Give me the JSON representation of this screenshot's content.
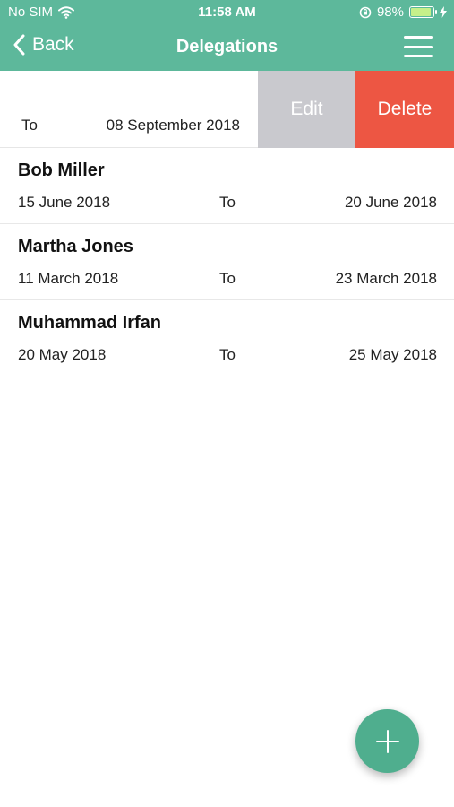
{
  "status_bar": {
    "carrier": "No SIM",
    "time": "11:58 AM",
    "battery_percent": "98%"
  },
  "nav": {
    "back_label": "Back",
    "title": "Delegations"
  },
  "swiped_row": {
    "to_label": "To",
    "end_date": "08 September 2018",
    "edit_label": "Edit",
    "delete_label": "Delete"
  },
  "delegations": [
    {
      "name": "Bob Miller",
      "start_date": "15 June 2018",
      "to_label": "To",
      "end_date": "20 June 2018"
    },
    {
      "name": "Martha Jones",
      "start_date": "11 March 2018",
      "to_label": "To",
      "end_date": "23 March 2018"
    },
    {
      "name": "Muhammad Irfan",
      "start_date": "20 May 2018",
      "to_label": "To",
      "end_date": "25 May 2018"
    }
  ],
  "colors": {
    "header": "#5db89b",
    "delete": "#ed5643",
    "edit": "#c9c9ce",
    "fab": "#4fae8e"
  },
  "fab": {
    "icon": "plus-icon"
  }
}
